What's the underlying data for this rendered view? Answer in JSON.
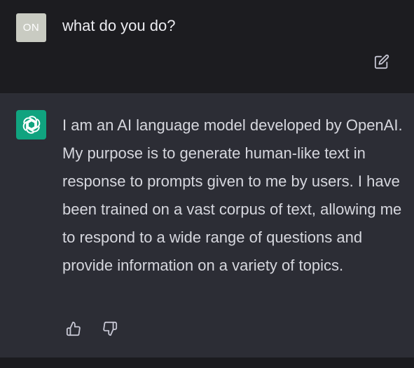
{
  "user_message": {
    "avatar_initials": "ON",
    "text": "what do you do?"
  },
  "assistant_message": {
    "text": "I am an AI language model developed by OpenAI. My purpose is to generate human-like text in response to prompts given to me by users. I have been trained on a vast corpus of text, allowing me to respond to a wide range of questions and provide information on a variety of topics."
  },
  "icons": {
    "edit": "edit-icon",
    "assistant_logo": "openai-logo-icon",
    "like": "thumbs-up-icon",
    "dislike": "thumbs-down-icon"
  },
  "colors": {
    "user_background": "#1c1c20",
    "assistant_background": "#2c2d35",
    "assistant_avatar": "#10a37f",
    "user_avatar": "#c9cbc2"
  }
}
